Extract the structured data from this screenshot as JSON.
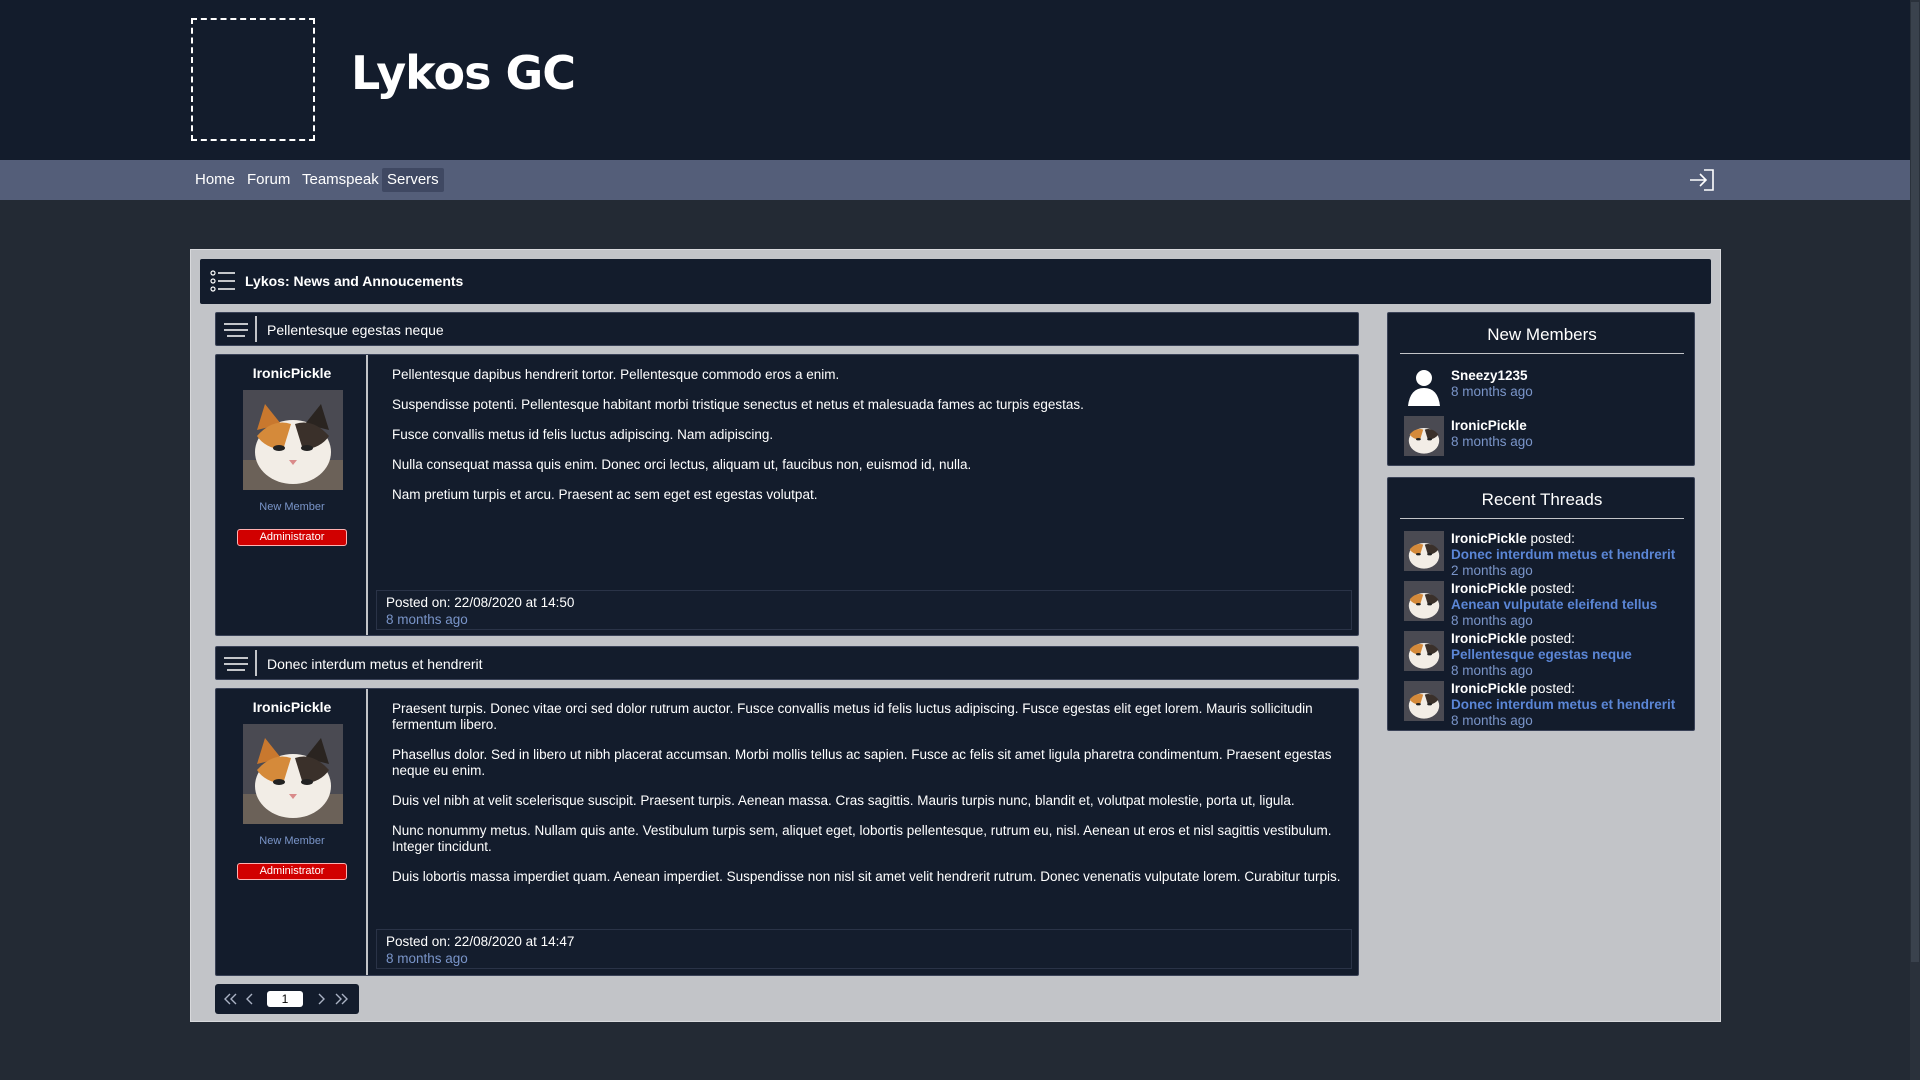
{
  "site": {
    "title": "Lykos GC"
  },
  "nav": {
    "items": [
      {
        "label": "Home"
      },
      {
        "label": "Forum"
      },
      {
        "label": "Teamspeak"
      },
      {
        "label": "Servers",
        "active": true
      }
    ],
    "login_icon": "login-icon"
  },
  "forum": {
    "title": "Lykos: News and Annoucements",
    "icon": "list-icon"
  },
  "threads": [
    {
      "title": "Pellentesque egestas neque",
      "author": "IronicPickle",
      "role": "New Member",
      "badge": "Administrator",
      "paragraphs": [
        "Pellentesque dapibus hendrerit tortor. Pellentesque commodo eros a enim.",
        "Suspendisse potenti. Pellentesque habitant morbi tristique senectus et netus et malesuada fames ac turpis egestas.",
        "Fusce convallis metus id felis luctus adipiscing. Nam adipiscing.",
        "Nulla consequat massa quis enim. Donec orci lectus, aliquam ut, faucibus non, euismod id, nulla.",
        "Nam pretium turpis et arcu. Praesent ac sem eget est egestas volutpat."
      ],
      "posted_on": "Posted on: 22/08/2020 at 14:50",
      "ago": "8 months ago"
    },
    {
      "title": "Donec interdum metus et hendrerit",
      "author": "IronicPickle",
      "role": "New Member",
      "badge": "Administrator",
      "paragraphs": [
        "Praesent turpis. Donec vitae orci sed dolor rutrum auctor. Fusce convallis metus id felis luctus adipiscing. Fusce egestas elit eget lorem. Mauris sollicitudin fermentum libero.",
        "Phasellus dolor. Sed in libero ut nibh placerat accumsan. Morbi mollis tellus ac sapien. Fusce ac felis sit amet ligula pharetra condimentum. Praesent egestas neque eu enim.",
        "Duis vel nibh at velit scelerisque suscipit. Praesent turpis. Aenean massa. Cras sagittis. Mauris turpis nunc, blandit et, volutpat molestie, porta ut, ligula.",
        "Nunc nonummy metus. Nullam quis ante. Vestibulum turpis sem, aliquet eget, lobortis pellentesque, rutrum eu, nisl. Aenean ut eros et nisl sagittis vestibulum. Integer tincidunt.",
        "Duis lobortis massa imperdiet quam. Aenean imperdiet. Suspendisse non nisl sit amet velit hendrerit rutrum. Donec venenatis vulputate lorem. Curabitur turpis."
      ],
      "posted_on": "Posted on: 22/08/2020 at 14:47",
      "ago": "8 months ago"
    }
  ],
  "pagination": {
    "current": "1",
    "icons": [
      "first-page-icon",
      "prev-page-icon",
      "next-page-icon",
      "last-page-icon"
    ]
  },
  "new_members": {
    "title": "New Members",
    "members": [
      {
        "name": "Sneezy1235",
        "ago": "8 months ago",
        "avatar": "default-user-icon"
      },
      {
        "name": "IronicPickle",
        "ago": "8 months ago",
        "avatar": "cat-avatar"
      }
    ]
  },
  "recent_threads": {
    "title": "Recent Threads",
    "items": [
      {
        "author": "IronicPickle",
        "verb": " posted:",
        "thread": "Donec interdum metus et hendrerit",
        "ago": "2 months ago"
      },
      {
        "author": "IronicPickle",
        "verb": " posted:",
        "thread": "Aenean vulputate eleifend tellus",
        "ago": "8 months ago"
      },
      {
        "author": "IronicPickle",
        "verb": " posted:",
        "thread": "Pellentesque egestas neque",
        "ago": "8 months ago"
      },
      {
        "author": "IronicPickle",
        "verb": " posted:",
        "thread": "Donec interdum metus et hendrerit",
        "ago": "8 months ago"
      }
    ]
  },
  "colors": {
    "header_bg": "#131c2c",
    "nav_bg": "#545e79",
    "page_bg": "#232a34",
    "panel_bg": "#c2c4c8",
    "link": "#5b86d6",
    "muted_link": "#7a95c9",
    "badge": "#d10000"
  }
}
